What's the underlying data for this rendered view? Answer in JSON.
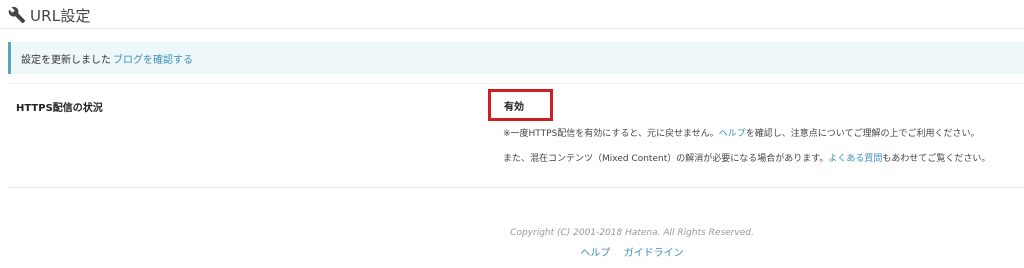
{
  "header": {
    "title": "URL設定",
    "icon": "wrench-icon"
  },
  "notice": {
    "message": "設定を更新しました",
    "link": "ブログを確認する"
  },
  "https": {
    "label": "HTTPS配信の状況",
    "status": "有効",
    "note1_before": "※一度HTTPS配信を有効にすると、元に戻せません。",
    "note1_link": "ヘルプ",
    "note1_after": "を確認し、注意点についてご理解の上でご利用ください。",
    "note2_before": "また、混在コンテンツ（Mixed Content）の解消が必要になる場合があります。",
    "note2_link": "よくある質問",
    "note2_after": "もあわせてご覧ください。"
  },
  "footer": {
    "copyright": "Copyright (C) 2001-2018 Hatena. All Rights Reserved.",
    "links": [
      "ヘルプ",
      "ガイドライン"
    ]
  },
  "colors": {
    "accent_link": "#3a8fb7",
    "notice_bg": "#eef7fa",
    "notice_border": "#5aa5b7",
    "highlight_box": "#cc1f25"
  }
}
